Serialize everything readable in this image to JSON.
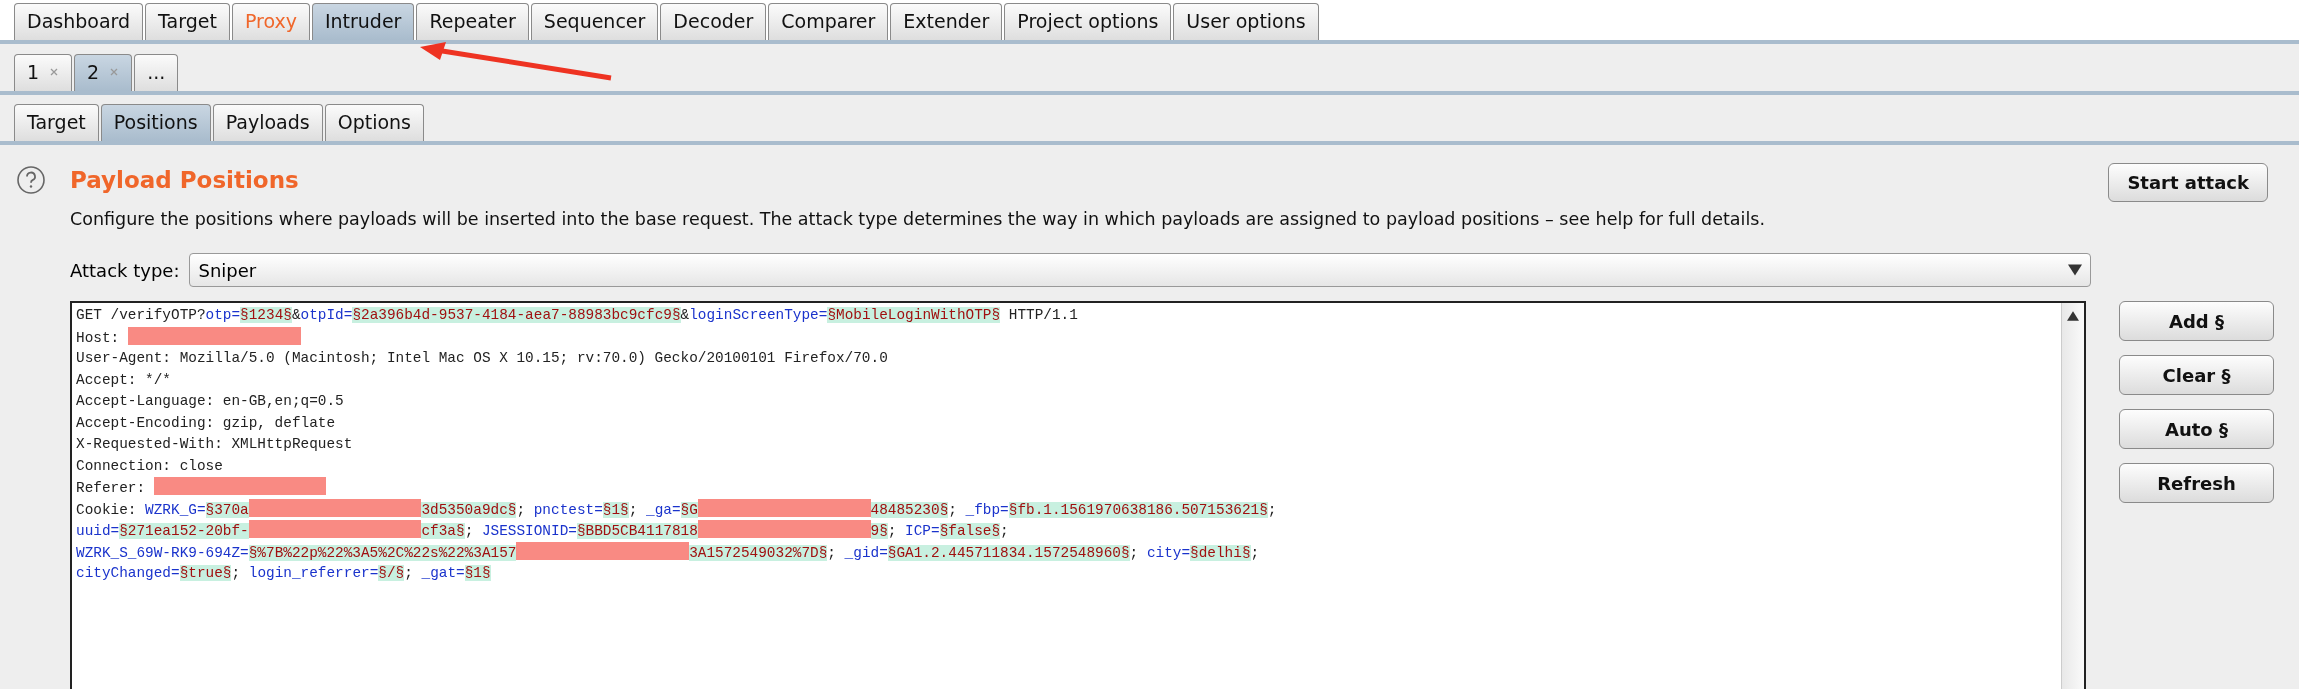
{
  "main_tabs": [
    {
      "label": "Dashboard",
      "selected": false,
      "highlighted": false
    },
    {
      "label": "Target",
      "selected": false,
      "highlighted": false
    },
    {
      "label": "Proxy",
      "selected": false,
      "highlighted": true
    },
    {
      "label": "Intruder",
      "selected": true,
      "highlighted": false
    },
    {
      "label": "Repeater",
      "selected": false,
      "highlighted": false
    },
    {
      "label": "Sequencer",
      "selected": false,
      "highlighted": false
    },
    {
      "label": "Decoder",
      "selected": false,
      "highlighted": false
    },
    {
      "label": "Comparer",
      "selected": false,
      "highlighted": false
    },
    {
      "label": "Extender",
      "selected": false,
      "highlighted": false
    },
    {
      "label": "Project options",
      "selected": false,
      "highlighted": false
    },
    {
      "label": "User options",
      "selected": false,
      "highlighted": false
    }
  ],
  "attack_tabs": [
    {
      "label": "1",
      "selected": false,
      "kind": "closable"
    },
    {
      "label": "2",
      "selected": true,
      "kind": "closable"
    },
    {
      "label": "...",
      "selected": false,
      "kind": "more"
    }
  ],
  "panel_tabs": [
    {
      "label": "Target",
      "selected": false
    },
    {
      "label": "Positions",
      "selected": true
    },
    {
      "label": "Payloads",
      "selected": false
    },
    {
      "label": "Options",
      "selected": false
    }
  ],
  "section": {
    "title": "Payload Positions",
    "description": "Configure the positions where payloads will be inserted into the base request. The attack type determines the way in which payloads are assigned to payload positions – see help for full details.",
    "start_button": "Start attack"
  },
  "attack_type": {
    "label": "Attack type:",
    "value": "Sniper"
  },
  "request_lines": [
    [
      {
        "kind": "plain",
        "text": "GET /verifyOTP?"
      },
      {
        "kind": "name",
        "text": "otp="
      },
      {
        "kind": "payload",
        "text": "§1234§"
      },
      {
        "kind": "plain",
        "text": "&"
      },
      {
        "kind": "name",
        "text": "otpId="
      },
      {
        "kind": "payload",
        "text": "§2a396b4d-9537-4184-aea7-88983bc9cfc9§"
      },
      {
        "kind": "plain",
        "text": "&"
      },
      {
        "kind": "name",
        "text": "loginScreenType="
      },
      {
        "kind": "payload",
        "text": "§MobileLoginWithOTP§"
      },
      {
        "kind": "plain",
        "text": " HTTP/1.1"
      }
    ],
    [
      {
        "kind": "plain",
        "text": "Host: "
      },
      {
        "kind": "redacted"
      }
    ],
    [
      {
        "kind": "plain",
        "text": "User-Agent: Mozilla/5.0 (Macintosh; Intel Mac OS X 10.15; rv:70.0) Gecko/20100101 Firefox/70.0"
      }
    ],
    [
      {
        "kind": "plain",
        "text": "Accept: */*"
      }
    ],
    [
      {
        "kind": "plain",
        "text": "Accept-Language: en-GB,en;q=0.5"
      }
    ],
    [
      {
        "kind": "plain",
        "text": "Accept-Encoding: gzip, deflate"
      }
    ],
    [
      {
        "kind": "plain",
        "text": "X-Requested-With: XMLHttpRequest"
      }
    ],
    [
      {
        "kind": "plain",
        "text": "Connection: close"
      }
    ],
    [
      {
        "kind": "plain",
        "text": "Referer: "
      },
      {
        "kind": "redacted"
      }
    ],
    [
      {
        "kind": "plain",
        "text": "Cookie: "
      },
      {
        "kind": "name",
        "text": "WZRK_G="
      },
      {
        "kind": "payload",
        "text": "§370a"
      },
      {
        "kind": "redacted"
      },
      {
        "kind": "payload",
        "text": "3d5350a9dc§"
      },
      {
        "kind": "plain",
        "text": "; "
      },
      {
        "kind": "name",
        "text": "pnctest="
      },
      {
        "kind": "payload",
        "text": "§1§"
      },
      {
        "kind": "plain",
        "text": "; "
      },
      {
        "kind": "name",
        "text": "_ga="
      },
      {
        "kind": "payload",
        "text": "§G"
      },
      {
        "kind": "redacted"
      },
      {
        "kind": "payload",
        "text": "48485230§"
      },
      {
        "kind": "plain",
        "text": "; "
      },
      {
        "kind": "name",
        "text": "_fbp="
      },
      {
        "kind": "payload",
        "text": "§fb.1.1561970638186.507153621§"
      },
      {
        "kind": "plain",
        "text": ";"
      }
    ],
    [
      {
        "kind": "name",
        "text": "uuid="
      },
      {
        "kind": "payload",
        "text": "§271ea152-20bf-"
      },
      {
        "kind": "redacted"
      },
      {
        "kind": "payload",
        "text": "cf3a§"
      },
      {
        "kind": "plain",
        "text": "; "
      },
      {
        "kind": "name",
        "text": "JSESSIONID="
      },
      {
        "kind": "payload",
        "text": "§BBD5CB4117818"
      },
      {
        "kind": "redacted"
      },
      {
        "kind": "payload",
        "text": "9§"
      },
      {
        "kind": "plain",
        "text": "; "
      },
      {
        "kind": "name",
        "text": "ICP="
      },
      {
        "kind": "payload",
        "text": "§false§"
      },
      {
        "kind": "plain",
        "text": ";"
      }
    ],
    [
      {
        "kind": "name",
        "text": "WZRK_S_69W-RK9-694Z="
      },
      {
        "kind": "payload",
        "text": "§%7B%22p%22%3A5%2C%22s%22%3A157"
      },
      {
        "kind": "redacted"
      },
      {
        "kind": "payload",
        "text": "3A1572549032%7D§"
      },
      {
        "kind": "plain",
        "text": "; "
      },
      {
        "kind": "name",
        "text": "_gid="
      },
      {
        "kind": "payload",
        "text": "§GA1.2.445711834.1572548960§"
      },
      {
        "kind": "plain",
        "text": "; "
      },
      {
        "kind": "name",
        "text": "city="
      },
      {
        "kind": "payload",
        "text": "§delhi§"
      },
      {
        "kind": "plain",
        "text": ";"
      }
    ],
    [
      {
        "kind": "name",
        "text": "cityChanged="
      },
      {
        "kind": "payload",
        "text": "§true§"
      },
      {
        "kind": "plain",
        "text": "; "
      },
      {
        "kind": "name",
        "text": "login_referrer="
      },
      {
        "kind": "payload",
        "text": "§/§"
      },
      {
        "kind": "plain",
        "text": "; "
      },
      {
        "kind": "name",
        "text": "_gat="
      },
      {
        "kind": "payload",
        "text": "§1§"
      }
    ]
  ],
  "side_buttons": [
    "Add §",
    "Clear §",
    "Auto §",
    "Refresh"
  ]
}
